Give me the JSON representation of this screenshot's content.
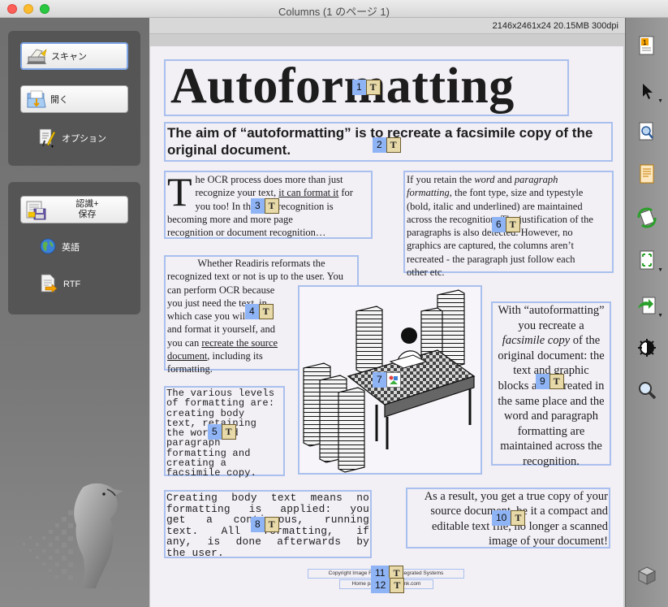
{
  "window": {
    "title": "Columns (1 のページ 1)"
  },
  "info_bar": {
    "text": "2146x2461x24  20.15MB  300dpi"
  },
  "left_panel": {
    "scan_label": "スキャン",
    "open_label": "開く",
    "options_label": "オプション",
    "recognize_save_label_1": "認識+",
    "recognize_save_label_2": "保存",
    "language_label": "英語",
    "format_label": "RTF"
  },
  "document": {
    "zone1": {
      "headline": "Autoformatting",
      "number": "1"
    },
    "zone2": {
      "text": "The aim of “autoformatting” is to recreate a facsimile copy of the original document.",
      "number": "2"
    },
    "zone3": {
      "dropcap": "T",
      "line1": "he OCR process does more than just",
      "line2a": "recognize your text, ",
      "line2b": "it can format it",
      "line2c": " for",
      "line3": "you too! In this text recognition is",
      "line4": "becoming more and more page",
      "line5": "recognition or document recognition…",
      "number": "3"
    },
    "zone4": {
      "line1": "Whether Readiris reformats the",
      "line2": "recognized text or not is up to the user. You",
      "line3": "can perform OCR because",
      "line4": "you just need the text, in",
      "line5": "which case you will edit",
      "line6": "and format it yourself, and",
      "line7a": "you can ",
      "line7b": "recreate the source",
      "line8a": "document",
      "line8b": ", including its",
      "line9": "formatting.",
      "number": "4"
    },
    "zone5": {
      "lines": [
        "The various levels",
        "of formatting are:",
        "creating body",
        "text, retaining",
        "the word and",
        "paragraph",
        "formatting and",
        "creating a",
        "facsimile copy."
      ],
      "number": "5"
    },
    "zone6": {
      "line1a": "If you retain the ",
      "line1b": "word",
      "line1c": " and ",
      "line1d": "paragraph",
      "line2a": "formatting",
      "line2b": ", the font type, size and typestyle",
      "line3": "(bold, italic and underlined) are maintained",
      "line4": "across the recognition. The justification of the",
      "line5": "paragraphs is also detected. However, no",
      "line6": "graphics are captured, the columns aren’t",
      "line7": "recreated - the paragraph just follow each",
      "line8": "other etc.",
      "number": "6"
    },
    "zone7": {
      "number": "7"
    },
    "zone8": {
      "lines": [
        "Creating body text means no",
        "formatting is applied: you",
        "get a continuous, running",
        "text. All formatting, if",
        "any, is done afterwards by",
        "the user."
      ],
      "number": "8"
    },
    "zone9": {
      "line1": "With “autoformatting”",
      "line2": "you recreate a",
      "line3": "facsimile copy",
      "line3b": " of the",
      "line4": "original document: the",
      "line5": "text and graphic",
      "line6": "blocks are recreated in",
      "line7": "the same place and the",
      "line8": "word and paragraph",
      "line9": "formatting are",
      "line10": "maintained across the",
      "line11": "recognition.",
      "number": "9"
    },
    "zone10": {
      "line1": "As a result, you get a true copy of your",
      "line2": "source document, be it a compact and",
      "line3": "editable text file, no longer a scanned",
      "line4": "image of your document!",
      "number": "10"
    },
    "zone11": {
      "text": "Copyright Image Recognition Integrated Systems",
      "number": "11"
    },
    "zone12": {
      "text": "Home page: www.irislink.com",
      "number": "12"
    }
  },
  "badge_glyph": "T"
}
